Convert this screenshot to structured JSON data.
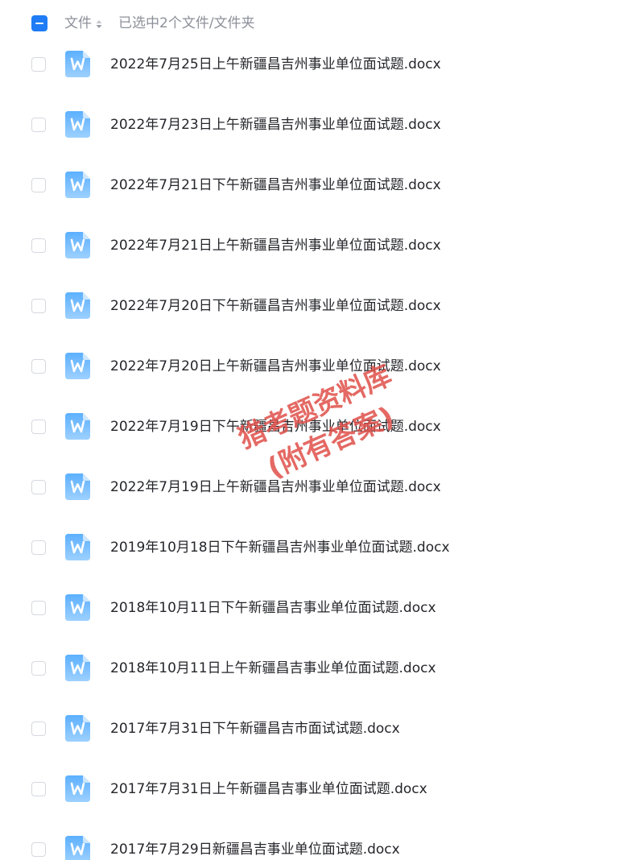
{
  "header": {
    "column_label": "文件",
    "selection_status": "已选中2个文件/文件夹"
  },
  "colors": {
    "accent": "#1f7cf5",
    "icon_gradient_top": "#5cb0ff",
    "icon_gradient_bottom": "#9dd0ff",
    "watermark": "#e0504a"
  },
  "icons": {
    "file_type": "word-doc-icon",
    "sort": "sort-icon",
    "master_checkbox": "indeterminate-checkbox-icon"
  },
  "files": [
    {
      "name": "2022年7月25日上午新疆昌吉州事业单位面试题.docx"
    },
    {
      "name": "2022年7月23日上午新疆昌吉州事业单位面试题.docx"
    },
    {
      "name": "2022年7月21日下午新疆昌吉州事业单位面试题.docx"
    },
    {
      "name": "2022年7月21日上午新疆昌吉州事业单位面试题.docx"
    },
    {
      "name": "2022年7月20日下午新疆昌吉州事业单位面试题.docx"
    },
    {
      "name": "2022年7月20日上午新疆昌吉州事业单位面试题.docx"
    },
    {
      "name": "2022年7月19日下午新疆昌吉州事业单位面试题.docx"
    },
    {
      "name": "2022年7月19日上午新疆昌吉州事业单位面试题.docx"
    },
    {
      "name": "2019年10月18日下午新疆昌吉州事业单位面试题.docx"
    },
    {
      "name": "2018年10月11日下午新疆昌吉事业单位面试题.docx"
    },
    {
      "name": "2018年10月11日上午新疆昌吉事业单位面试题.docx"
    },
    {
      "name": "2017年7月31日下午新疆昌吉市面试试题.docx"
    },
    {
      "name": "2017年7月31日上午新疆昌吉事业单位面试题.docx"
    },
    {
      "name": "2017年7月29日新疆昌吉事业单位面试题.docx"
    }
  ],
  "watermark": {
    "line1": "猎考题资料库",
    "line2": "(附有答案)"
  }
}
